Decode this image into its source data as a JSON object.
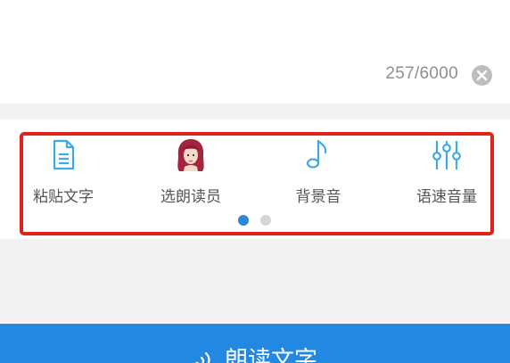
{
  "editor": {
    "char_count": "257/6000",
    "clear_icon": "close-icon"
  },
  "tools": [
    {
      "label": "粘贴文字",
      "icon": "document-icon"
    },
    {
      "label": "选朗读员",
      "icon": "reader-avatar-icon"
    },
    {
      "label": "背景音",
      "icon": "music-note-icon"
    },
    {
      "label": "语速音量",
      "icon": "equalizer-icon"
    }
  ],
  "pager": {
    "pages": 2,
    "active": 1
  },
  "action": {
    "label": "朗读文字",
    "icon": "sound-wave-icon"
  },
  "colors": {
    "accent": "#2288e2",
    "icon_blue": "#3fa9e8",
    "highlight": "#e0221c",
    "dot_active": "#2f86d8",
    "dot_inactive": "#d6d6d6"
  }
}
